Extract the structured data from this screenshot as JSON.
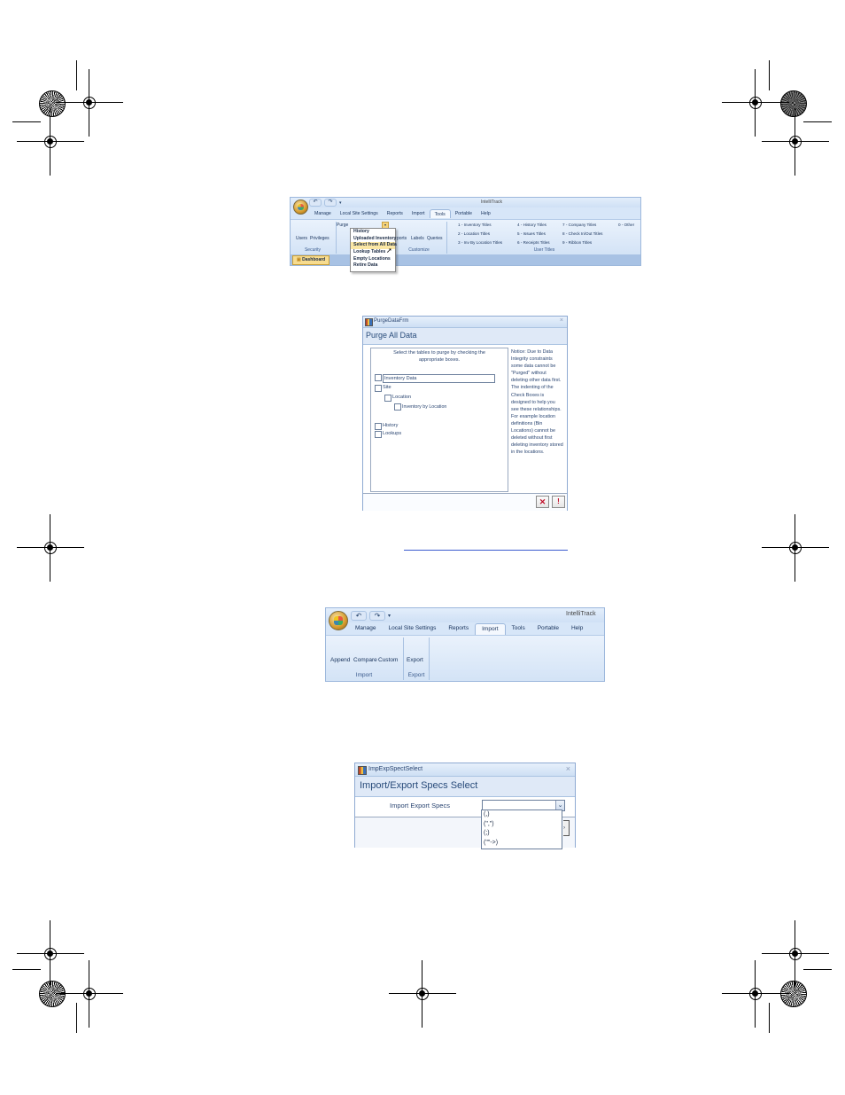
{
  "ribbon1": {
    "app_title": "IntelliTrack",
    "tabs": [
      "Manage",
      "Local Site Settings",
      "Reports",
      "Import",
      "Tools",
      "Portable",
      "Help"
    ],
    "active_tab": "Tools",
    "security_buttons": [
      "Users",
      "Privileges"
    ],
    "security_label": "Security",
    "purge_label": "Purge",
    "customize_buttons": [
      "ports",
      "Labels",
      "Queries"
    ],
    "customize_label": "Customize",
    "user_titles_label": "User Titles",
    "user_titles": [
      "1 - Inventory Titles",
      "2 - Location Titles",
      "3 - Inv By Location Titles",
      "4 - History Titles",
      "5 - Issues Titles",
      "6 - Receipts Titles",
      "7 - Company Titles",
      "8 - Check In/Out Titles",
      "9 - Ribbon Titles",
      "0 - Other"
    ],
    "dashboard_tab": "Dashboard",
    "menu_items": [
      "History",
      "Uploaded Inventory",
      "Select from All Data",
      "Lookup Tables",
      "Empty Locations",
      "Retire Data"
    ],
    "menu_highlight": "Select from All Data"
  },
  "purge_form": {
    "window_title": "PurgeDataFrm",
    "heading": "Purge All Data",
    "instruction": "Select the tables to purge by checking the appropriate boxes.",
    "checkboxes": [
      "Inventory Data",
      "Site",
      "Location",
      "Inventory by Location",
      "History",
      "Lookups"
    ],
    "notice": "Notice: Due to Data Integrity constraints some data cannot be \"Purged\" without deleting other data first. The indenting of the Check Boxes is designed to help you see these relationships. For example location definitions (Bin Locations) cannot be deleted without first deleting inventory stored in the locations.",
    "close_glyph": "✕",
    "run_glyph": "!"
  },
  "ribbon2": {
    "app_title": "IntelliTrack",
    "tabs": [
      "Manage",
      "Local Site Settings",
      "Reports",
      "Import",
      "Tools",
      "Portable",
      "Help"
    ],
    "active_tab": "Import",
    "import_buttons": [
      "Append",
      "Compare",
      "Custom"
    ],
    "import_label": "Import",
    "export_buttons": [
      "Export"
    ],
    "export_label": "Export"
  },
  "specs_form": {
    "window_title": "ImpExpSpectSelect",
    "heading": "Import/Export Specs Select",
    "field_label": "Import Export Specs",
    "options": [
      "(,)",
      "(\",\")",
      "(;)",
      "(\"\"->)"
    ]
  },
  "colors": {
    "ribbon_bg": "#d7e6f8",
    "active_tab_bg": "#f4f8fe",
    "highlight": "#fbe7a4",
    "run_red": "#c0102a",
    "link_blue": "#3b5bcf"
  }
}
